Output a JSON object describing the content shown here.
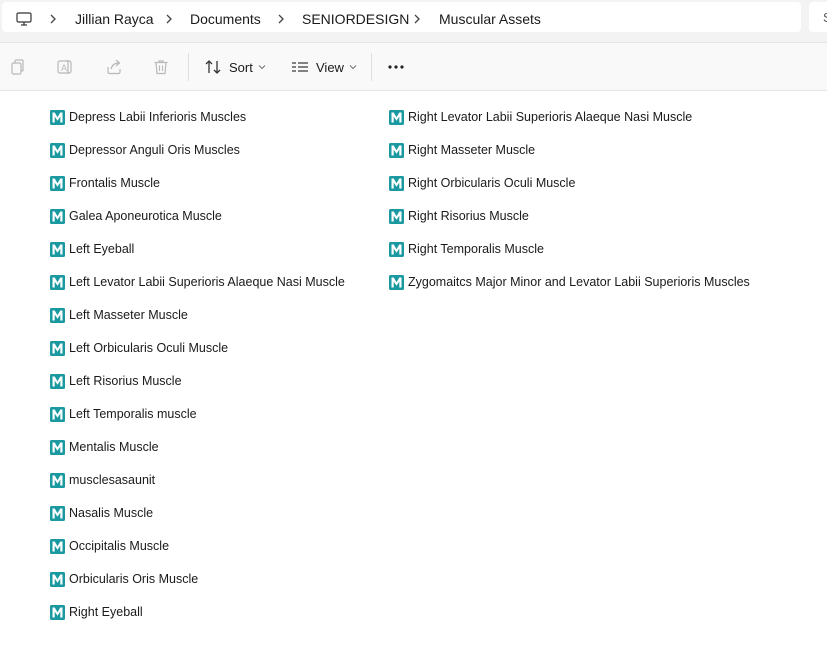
{
  "address_bar": {
    "computer_icon": "computer-icon",
    "breadcrumb": [
      {
        "label": "Jillian Rayca"
      },
      {
        "label": "Documents"
      },
      {
        "label": "SENIORDESIGN"
      },
      {
        "label": "Muscular Assets"
      }
    ],
    "search_fragment": "S"
  },
  "toolbar": {
    "copy_icon": "copy-icon",
    "rename_icon": "rename-icon",
    "share_icon": "share-icon",
    "delete_icon": "trash-icon",
    "sort_label": "Sort",
    "view_label": "View",
    "more_icon": "more-icon"
  },
  "file_icon": {
    "name": "maya-file-icon",
    "color": "#1a9aa0"
  },
  "files": {
    "column1": [
      {
        "name": "Depress Labii Inferioris Muscles"
      },
      {
        "name": "Depressor Anguli Oris Muscles"
      },
      {
        "name": "Frontalis Muscle"
      },
      {
        "name": "Galea Aponeurotica Muscle"
      },
      {
        "name": "Left Eyeball"
      },
      {
        "name": "Left Levator Labii Superioris Alaeque Nasi Muscle"
      },
      {
        "name": "Left Masseter Muscle"
      },
      {
        "name": "Left Orbicularis Oculi Muscle"
      },
      {
        "name": "Left Risorius Muscle"
      },
      {
        "name": "Left Temporalis muscle"
      },
      {
        "name": "Mentalis Muscle"
      },
      {
        "name": "musclesasaunit"
      },
      {
        "name": "Nasalis Muscle"
      },
      {
        "name": "Occipitalis Muscle"
      },
      {
        "name": "Orbicularis Oris Muscle"
      },
      {
        "name": "Right Eyeball"
      }
    ],
    "column2": [
      {
        "name": "Right Levator Labii Superioris Alaeque Nasi Muscle"
      },
      {
        "name": "Right Masseter Muscle"
      },
      {
        "name": "Right Orbicularis Oculi Muscle"
      },
      {
        "name": "Right Risorius Muscle"
      },
      {
        "name": "Right Temporalis Muscle"
      },
      {
        "name": "Zygomaitcs Major Minor and Levator Labii Superioris Muscles"
      }
    ]
  }
}
